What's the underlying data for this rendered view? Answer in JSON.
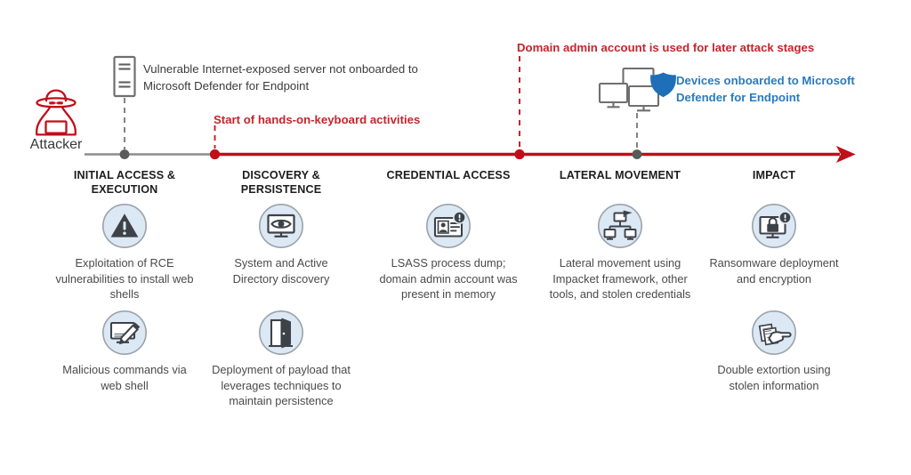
{
  "colors": {
    "red": "#C3262B",
    "red_dark": "#C00F19",
    "blue": "#2A7BC0",
    "shield_blue": "#1E6FB8",
    "gray_line": "#8d8d8d",
    "gray_dot": "#5a5a5a",
    "icon_fill": "#DCE8F4",
    "icon_stroke": "#9aa3ab",
    "text": "#4a4a4a"
  },
  "attacker": {
    "label": "Attacker",
    "icon": "attacker-hat-laptop-icon"
  },
  "callouts": [
    {
      "id": "server",
      "icon": "server-rack-icon",
      "text": "Vulnerable Internet-exposed server not onboarded to Microsoft Defender for Endpoint",
      "color": "#3b3b3b"
    },
    {
      "id": "devices",
      "icon": "monitors-with-shield-icon",
      "text": "Devices onboarded to Microsoft Defender for Endpoint",
      "color": "#2A7BC0"
    }
  ],
  "annotations": [
    {
      "id": "hands-on-keyboard",
      "text": "Start of hands-on-keyboard activities",
      "color": "#C3262B"
    },
    {
      "id": "domain-admin",
      "text": "Domain admin account is used for later attack stages",
      "color": "#C3262B"
    }
  ],
  "timeline": {
    "stages": [
      {
        "id": "initial-access",
        "line1": "INITIAL ACCESS &",
        "line2": "EXECUTION"
      },
      {
        "id": "discovery",
        "line1": "DISCOVERY &",
        "line2": "PERSISTENCE"
      },
      {
        "id": "credential-access",
        "line1": "CREDENTIAL ACCESS",
        "line2": ""
      },
      {
        "id": "lateral-movement",
        "line1": "LATERAL MOVEMENT",
        "line2": ""
      },
      {
        "id": "impact",
        "line1": "IMPACT",
        "line2": ""
      }
    ]
  },
  "columns": [
    {
      "id": "initial-access",
      "items": [
        {
          "icon": "warning-triangle-icon",
          "text": "Exploitation of RCE vulnerabilities to install web shells"
        },
        {
          "icon": "monitor-pen-icon",
          "text": "Malicious commands via web shell"
        }
      ]
    },
    {
      "id": "discovery",
      "items": [
        {
          "icon": "monitor-eye-icon",
          "text": "System and Active Directory discovery"
        },
        {
          "icon": "open-door-icon",
          "text": "Deployment of payload that leverages techniques to maintain persistence"
        }
      ]
    },
    {
      "id": "credential-access",
      "items": [
        {
          "icon": "id-card-alert-icon",
          "text": "LSASS process dump; domain admin account was present in memory"
        }
      ]
    },
    {
      "id": "lateral-movement",
      "items": [
        {
          "icon": "network-nodes-icon",
          "text": "Lateral movement using Impacket framework, other tools, and stolen credentials"
        }
      ]
    },
    {
      "id": "impact",
      "items": [
        {
          "icon": "monitor-lock-alert-icon",
          "text": "Ransomware deployment and encryption"
        },
        {
          "icon": "hand-documents-icon",
          "text": "Double extortion using stolen information"
        }
      ]
    }
  ]
}
